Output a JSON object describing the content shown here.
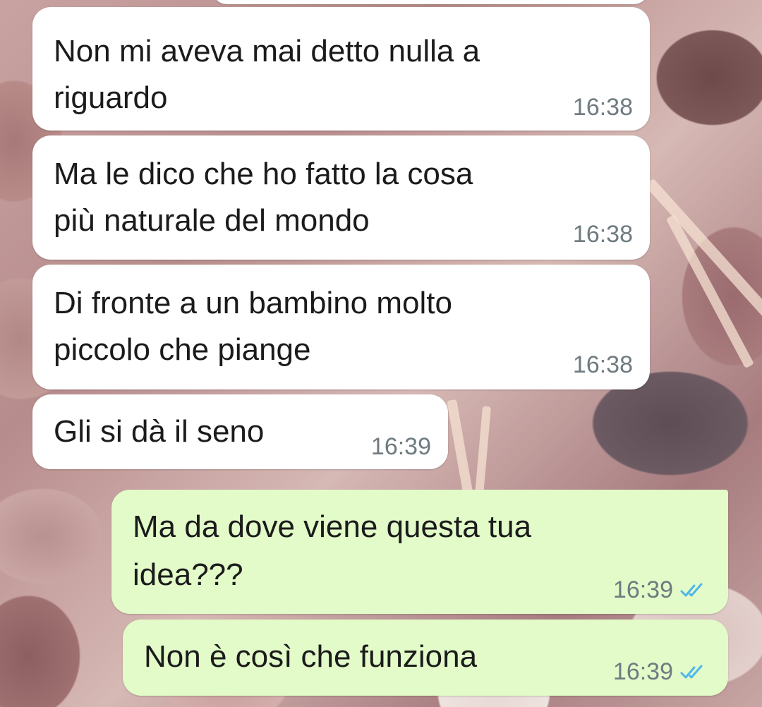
{
  "messages": [
    {
      "direction": "incoming",
      "lines": [
        "Non mi aveva mai detto nulla a",
        "riguardo"
      ],
      "time": "16:38"
    },
    {
      "direction": "incoming",
      "lines": [
        "Ma le dico che ho fatto la cosa",
        "più naturale del mondo"
      ],
      "time": "16:38"
    },
    {
      "direction": "incoming",
      "lines": [
        "Di fronte a un bambino molto",
        "piccolo che piange"
      ],
      "time": "16:38"
    },
    {
      "direction": "incoming",
      "lines": [
        "Gli si dà il seno"
      ],
      "time": "16:39"
    },
    {
      "direction": "outgoing",
      "lines": [
        "Ma da dove viene questa tua",
        "idea???"
      ],
      "time": "16:39",
      "status_icon": "double-check-icon",
      "status_color": "#4fb6ec"
    },
    {
      "direction": "outgoing",
      "lines": [
        "Non è così che funziona"
      ],
      "time": "16:39",
      "status_icon": "double-check-icon",
      "status_color": "#4fb6ec"
    }
  ],
  "colors": {
    "incoming_bubble": "#ffffff",
    "outgoing_bubble": "#e2fbc9",
    "read_receipt": "#4fb6ec"
  }
}
